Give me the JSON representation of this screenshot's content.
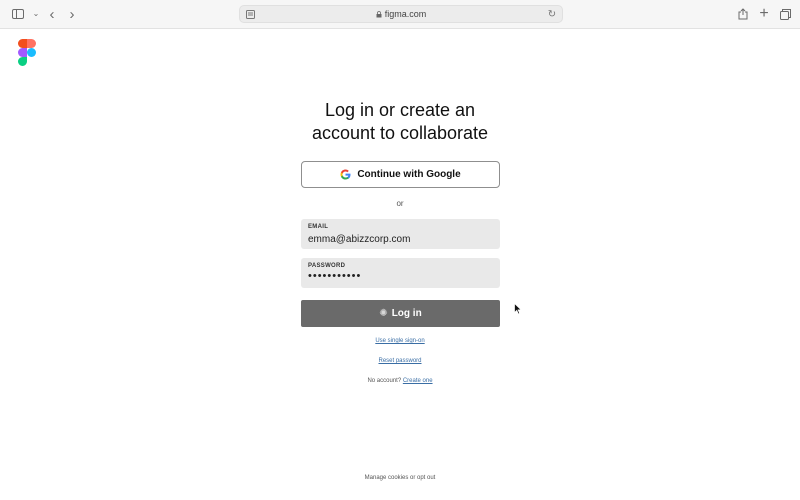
{
  "browser": {
    "url": "figma.com",
    "icons": {
      "sidebar": "sidebar-icon",
      "back": "chevron-left-icon",
      "forward": "chevron-right-icon",
      "share": "share-icon",
      "new_tab": "plus-icon",
      "tabs": "tabs-icon",
      "reload": "reload-icon",
      "lock": "lock-icon"
    }
  },
  "page": {
    "title_line1": "Log in or create an",
    "title_line2": "account to collaborate",
    "google_button": "Continue with Google",
    "or_text": "or",
    "email_label": "EMAIL",
    "email_value": "emma@abizzcorp.com",
    "password_label": "PASSWORD",
    "password_value": "•••••••••••",
    "login_button": "Log in",
    "sso_link": "Use single sign-on",
    "reset_link": "Reset password",
    "no_account_text": "No account?",
    "create_link": "Create one",
    "cookies_link": "Manage cookies or opt out"
  },
  "colors": {
    "login_button": "#6a6a6a",
    "link": "#3a6ea5",
    "field_bg": "#e9e9e9"
  }
}
